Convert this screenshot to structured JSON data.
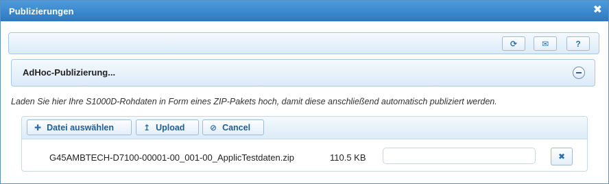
{
  "window": {
    "title": "Publizierungen",
    "close_icon": "✖"
  },
  "toolbar": {
    "refresh_icon": "⟳",
    "mail_icon": "✉",
    "help_label": "?"
  },
  "panel": {
    "title": "AdHoc-Publizierung...",
    "hint": "Laden Sie hier Ihre S1000D-Rohdaten in Form eines ZIP-Pakets hoch, damit diese anschließend automatisch publiziert werden."
  },
  "upload": {
    "choose_icon": "✚",
    "choose_label": "Datei auswählen",
    "upload_icon": "↥",
    "upload_label": "Upload",
    "cancel_icon": "⊘",
    "cancel_label": "Cancel"
  },
  "file": {
    "name": "G45AMBTECH-D7100-00001-00_001-00_ApplicTestdaten.zip",
    "size": "110.5 KB",
    "progress_percent": 0,
    "remove_icon": "✖"
  },
  "colors": {
    "titlebar": "#2f78c0",
    "accent": "#2a6eab",
    "panel_bg": "#dcebf8"
  }
}
